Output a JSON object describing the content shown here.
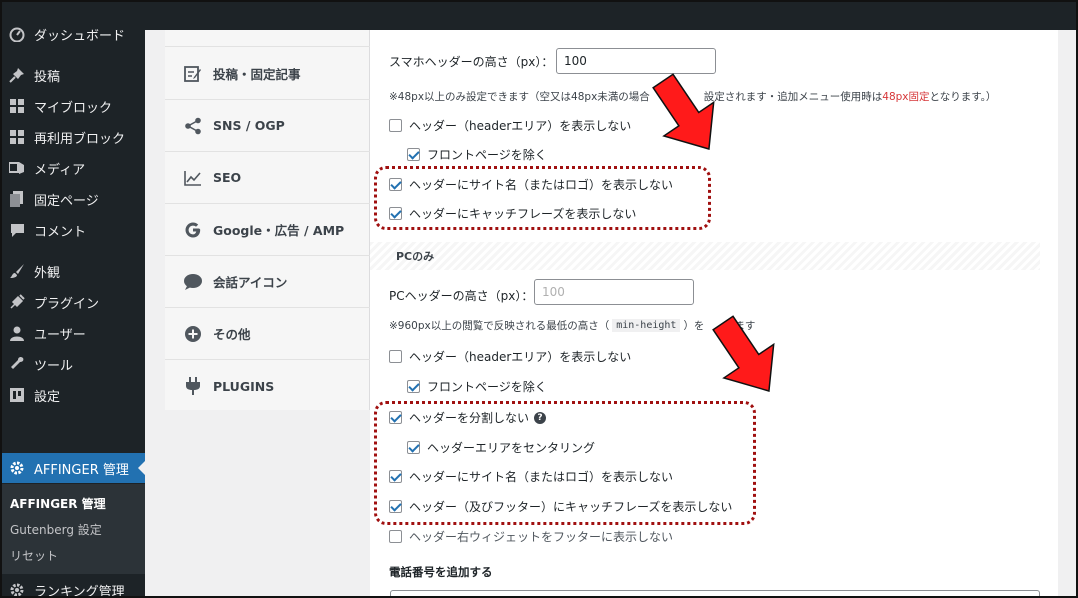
{
  "sidebar": {
    "items": [
      {
        "label": "ダッシュボード",
        "icon": "dashboard-icon"
      },
      {
        "label": "投稿",
        "icon": "pin-icon"
      },
      {
        "label": "マイブロック",
        "icon": "blocks-icon"
      },
      {
        "label": "再利用ブロック",
        "icon": "blocks-icon"
      },
      {
        "label": "メディア",
        "icon": "media-icon"
      },
      {
        "label": "固定ページ",
        "icon": "page-icon"
      },
      {
        "label": "コメント",
        "icon": "comment-icon"
      },
      {
        "label": "外観",
        "icon": "brush-icon"
      },
      {
        "label": "プラグイン",
        "icon": "plugin-icon"
      },
      {
        "label": "ユーザー",
        "icon": "user-icon"
      },
      {
        "label": "ツール",
        "icon": "wrench-icon"
      },
      {
        "label": "設定",
        "icon": "settings-icon"
      }
    ],
    "current": {
      "label": "AFFINGER 管理",
      "icon": "gear-icon"
    },
    "submenu": [
      "AFFINGER 管理",
      "Gutenberg 設定",
      "リセット"
    ],
    "next": {
      "label": "ランキング管理",
      "icon": "gear-icon"
    }
  },
  "settings_nav": [
    {
      "label": "投稿・固定記事",
      "icon": "edit-icon"
    },
    {
      "label": "SNS / OGP",
      "icon": "share-icon"
    },
    {
      "label": "SEO",
      "icon": "chart-line-icon"
    },
    {
      "label": "Google・広告 / AMP",
      "icon": "google-icon"
    },
    {
      "label": "会話アイコン",
      "icon": "speech-bubble-icon"
    },
    {
      "label": "その他",
      "icon": "plus-circle-icon"
    },
    {
      "label": "PLUGINS",
      "icon": "plug-icon"
    }
  ],
  "smartphone": {
    "height_label": "スマホヘッダーの高さ（px）：",
    "height_value": "100",
    "note_a": "※48px以上のみ設定できます（空又は48px未満の場合",
    "note_b": "設定されます・追加メニュー使用時は",
    "note_red": "48px固定",
    "note_c": "となります。）",
    "hide_header": "ヘッダー（headerエリア）を表示しない",
    "exclude_front": "フロントページを除く",
    "hide_sitename": "ヘッダーにサイト名（またはロゴ）を表示しない",
    "hide_catch": "ヘッダーにキャッチフレーズを表示しない"
  },
  "pc": {
    "section": "PCのみ",
    "height_label": "PCヘッダーの高さ（px）：",
    "height_placeholder": "100",
    "note_a": "※960px以上の閲覧で反映される最低の高さ（",
    "note_code": "min-height",
    "note_b": "）を",
    "note_c": "ます",
    "hide_header": "ヘッダー（headerエリア）を表示しない",
    "exclude_front": "フロントページを除く",
    "no_split": "ヘッダーを分割しない",
    "help": "?",
    "center": "ヘッダーエリアをセンタリング",
    "hide_sitename": "ヘッダーにサイト名（またはロゴ）を表示しない",
    "hide_catch": "ヘッダー（及びフッター）にキャッチフレーズを表示しない",
    "widget_footer": "ヘッダー右ウィジェットをフッターに表示しない"
  },
  "phone_section": "電話番号を追加する",
  "colors": {
    "accent": "#2271b1",
    "arrow": "#ff0000",
    "highlight": "#a01010",
    "note_red": "#d63638"
  }
}
